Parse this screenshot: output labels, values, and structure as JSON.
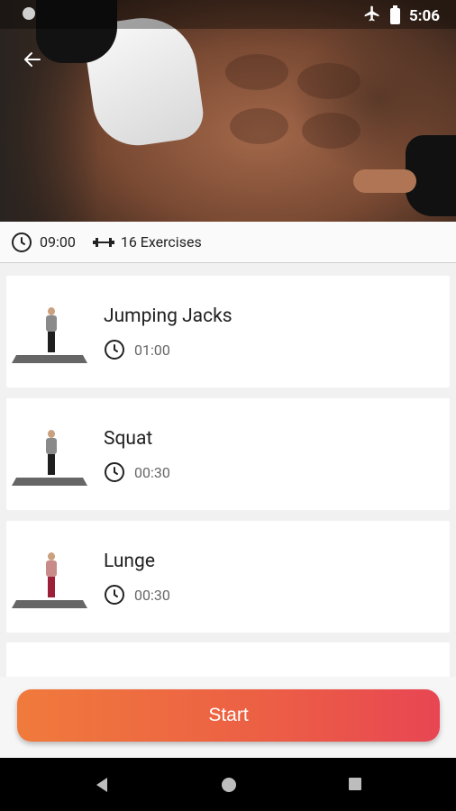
{
  "status_bar": {
    "time": "5:06"
  },
  "info": {
    "duration": "09:00",
    "exercises_count": "16 Exercises"
  },
  "exercises": [
    {
      "name": "Jumping Jacks",
      "duration": "01:00"
    },
    {
      "name": "Squat",
      "duration": "00:30"
    },
    {
      "name": "Lunge",
      "duration": "00:30"
    }
  ],
  "start_label": "Start",
  "colors": {
    "accent_start": "#f07a3c",
    "accent_end": "#e84653"
  }
}
